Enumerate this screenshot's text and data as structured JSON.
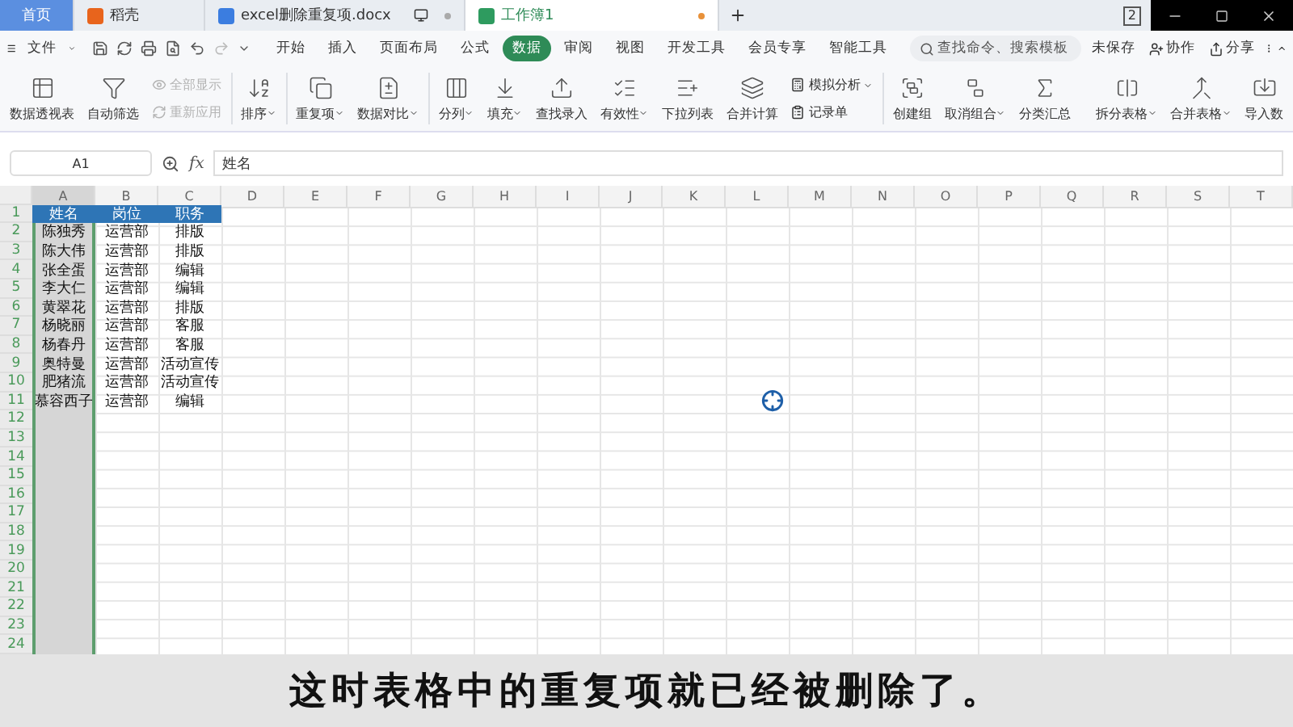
{
  "doc_tabs": [
    {
      "label": "首页",
      "kind": "home",
      "selected": false
    },
    {
      "label": "稻壳",
      "kind": "docer",
      "selected": false
    },
    {
      "label": "excel删除重复项.docx",
      "kind": "word",
      "selected": false
    },
    {
      "label": "工作簿1",
      "kind": "sheet",
      "selected": true
    }
  ],
  "window_badge": "2",
  "menu": {
    "file": "文件",
    "tabs": [
      {
        "label": "开始",
        "selected": false
      },
      {
        "label": "插入",
        "selected": false
      },
      {
        "label": "页面布局",
        "selected": false
      },
      {
        "label": "公式",
        "selected": false
      },
      {
        "label": "数据",
        "selected": true
      },
      {
        "label": "审阅",
        "selected": false
      },
      {
        "label": "视图",
        "selected": false
      },
      {
        "label": "开发工具",
        "selected": false
      },
      {
        "label": "会员专享",
        "selected": false
      },
      {
        "label": "智能工具",
        "selected": false
      }
    ],
    "search": {
      "placeholder": "查找命令、搜索模板"
    },
    "save_state": "未保存",
    "collaborate": "协作",
    "share": "分享"
  },
  "ribbon": [
    {
      "kind": "big",
      "label": "数据透视表",
      "dropdown": false
    },
    {
      "kind": "big",
      "label": "自动筛选",
      "dropdown": false
    },
    {
      "kind": "stack",
      "items": [
        {
          "label": "全部显示",
          "disabled": true,
          "dropdown": false
        },
        {
          "label": "重新应用",
          "disabled": true,
          "dropdown": false
        }
      ]
    },
    {
      "kind": "sep"
    },
    {
      "kind": "big",
      "label": "排序",
      "dropdown": true
    },
    {
      "kind": "sep"
    },
    {
      "kind": "big",
      "label": "重复项",
      "dropdown": true
    },
    {
      "kind": "big",
      "label": "数据对比",
      "dropdown": true
    },
    {
      "kind": "sep"
    },
    {
      "kind": "big",
      "label": "分列",
      "dropdown": true
    },
    {
      "kind": "big",
      "label": "填充",
      "dropdown": true
    },
    {
      "kind": "big",
      "label": "查找录入",
      "dropdown": false
    },
    {
      "kind": "big",
      "label": "有效性",
      "dropdown": true
    },
    {
      "kind": "big",
      "label": "下拉列表",
      "dropdown": false
    },
    {
      "kind": "big",
      "label": "合并计算",
      "dropdown": false
    },
    {
      "kind": "stack",
      "items": [
        {
          "label": "模拟分析",
          "disabled": false,
          "dropdown": true
        },
        {
          "label": "记录单",
          "disabled": false,
          "dropdown": false
        }
      ]
    },
    {
      "kind": "sep"
    },
    {
      "kind": "big",
      "label": "创建组",
      "dropdown": false
    },
    {
      "kind": "big",
      "label": "取消组合",
      "dropdown": true
    },
    {
      "kind": "big",
      "label": "分类汇总",
      "dropdown": false
    },
    {
      "kind": "gap"
    },
    {
      "kind": "big",
      "label": "拆分表格",
      "dropdown": true
    },
    {
      "kind": "big",
      "label": "合并表格",
      "dropdown": true
    },
    {
      "kind": "big",
      "label": "导入数",
      "dropdown": false
    }
  ],
  "name_box": "A1",
  "function_label": "fx",
  "formula": "姓名",
  "columns": [
    {
      "label": "A",
      "selected": true
    },
    {
      "label": "B",
      "selected": false
    },
    {
      "label": "C",
      "selected": false
    },
    {
      "label": "D",
      "selected": false
    },
    {
      "label": "E",
      "selected": false
    },
    {
      "label": "F",
      "selected": false
    },
    {
      "label": "G",
      "selected": false
    },
    {
      "label": "H",
      "selected": false
    },
    {
      "label": "I",
      "selected": false
    },
    {
      "label": "J",
      "selected": false
    },
    {
      "label": "K",
      "selected": false
    },
    {
      "label": "L",
      "selected": false
    },
    {
      "label": "M",
      "selected": false
    },
    {
      "label": "N",
      "selected": false
    },
    {
      "label": "O",
      "selected": false
    },
    {
      "label": "P",
      "selected": false
    },
    {
      "label": "Q",
      "selected": false
    },
    {
      "label": "R",
      "selected": false
    },
    {
      "label": "S",
      "selected": false
    },
    {
      "label": "T",
      "selected": false
    }
  ],
  "rows": [
    {
      "number": "1",
      "kind": "header",
      "cells": [
        "姓名",
        "岗位",
        "职务"
      ]
    },
    {
      "number": "2",
      "kind": "data",
      "cells": [
        "陈独秀",
        "运营部",
        "排版"
      ]
    },
    {
      "number": "3",
      "kind": "data",
      "cells": [
        "陈大伟",
        "运营部",
        "排版"
      ]
    },
    {
      "number": "4",
      "kind": "data",
      "cells": [
        "张全蛋",
        "运营部",
        "编辑"
      ]
    },
    {
      "number": "5",
      "kind": "data",
      "cells": [
        "李大仁",
        "运营部",
        "编辑"
      ]
    },
    {
      "number": "6",
      "kind": "data",
      "cells": [
        "黄翠花",
        "运营部",
        "排版"
      ]
    },
    {
      "number": "7",
      "kind": "data",
      "cells": [
        "杨晓丽",
        "运营部",
        "客服"
      ]
    },
    {
      "number": "8",
      "kind": "data",
      "cells": [
        "杨春丹",
        "运营部",
        "客服"
      ]
    },
    {
      "number": "9",
      "kind": "data",
      "cells": [
        "奥特曼",
        "运营部",
        "活动宣传"
      ]
    },
    {
      "number": "10",
      "kind": "data",
      "cells": [
        "肥猪流",
        "运营部",
        "活动宣传"
      ]
    },
    {
      "number": "11",
      "kind": "data",
      "cells": [
        "慕容西子",
        "运营部",
        "编辑"
      ]
    },
    {
      "number": "12",
      "kind": "data",
      "cells": []
    },
    {
      "number": "13",
      "kind": "data",
      "cells": []
    },
    {
      "number": "14",
      "kind": "data",
      "cells": []
    },
    {
      "number": "15",
      "kind": "data",
      "cells": []
    },
    {
      "number": "16",
      "kind": "data",
      "cells": []
    },
    {
      "number": "17",
      "kind": "data",
      "cells": []
    },
    {
      "number": "18",
      "kind": "data",
      "cells": []
    },
    {
      "number": "19",
      "kind": "data",
      "cells": []
    },
    {
      "number": "20",
      "kind": "data",
      "cells": []
    },
    {
      "number": "21",
      "kind": "data",
      "cells": []
    },
    {
      "number": "22",
      "kind": "data",
      "cells": []
    },
    {
      "number": "23",
      "kind": "data",
      "cells": []
    },
    {
      "number": "24",
      "kind": "data",
      "cells": []
    }
  ],
  "subtitle": "这时表格中的重复项就已经被删除了。"
}
